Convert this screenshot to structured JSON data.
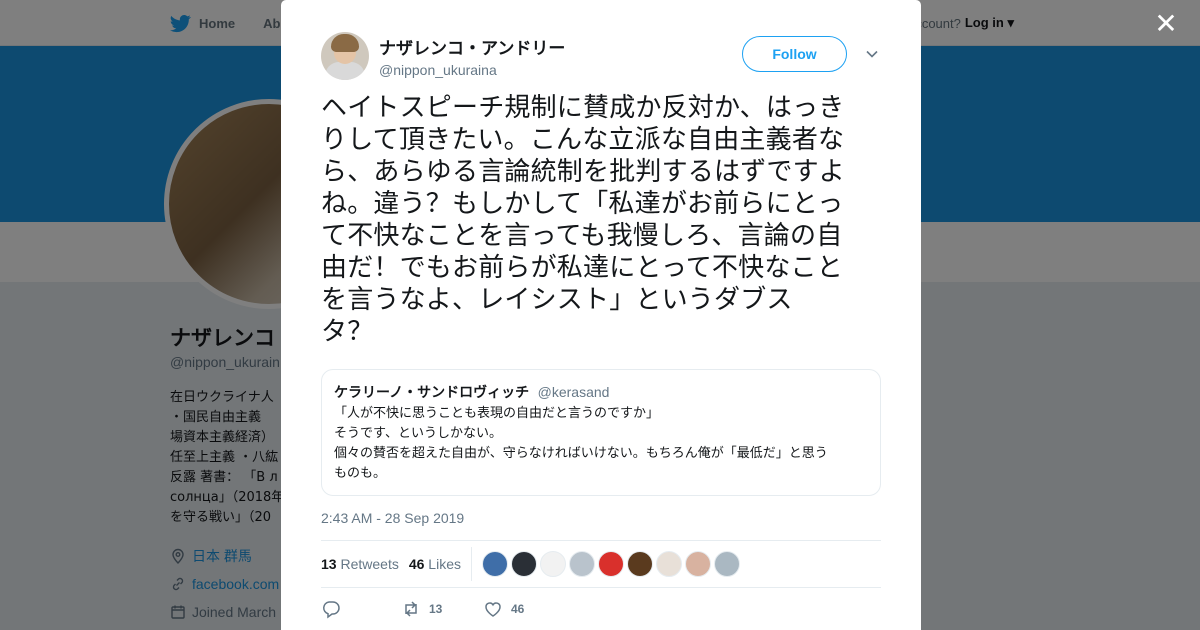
{
  "nav": {
    "home": "Home",
    "about_partial": "Abo",
    "account_partial": "ccount?",
    "login": "Log in"
  },
  "profile": {
    "name_partial": "ナザレンコ",
    "handle_partial": "@nippon_ukurain",
    "bio_lines": [
      "在日ウクライナ人",
      "・国民自由主義",
      "場資本主義経済）",
      "任至上主義 ・八紘",
      "反露 著書： 「В л",
      "солнца」（2018年",
      "を守る戦い」（20"
    ],
    "location": "日本 群馬",
    "website_partial": "facebook.com",
    "joined_partial": "Joined March"
  },
  "tweet": {
    "author_name": "ナザレンコ・アンドリー",
    "author_handle": "@nippon_ukuraina",
    "follow_label": "Follow",
    "text": "ヘイトスピーチ規制に賛成か反対か、はっき\nりして頂きたい。こんな立派な自由主義者な\nら、あらゆる言論統制を批判するはずですよ\nね。違う？もしかして「私達がお前らにとっ\nて不快なことを言っても我慢しろ、言論の自\n由だ！でもお前らが私達にとって不快なこと\nを言うなよ、レイシスト」というダブス\nタ？",
    "quote": {
      "name": "ケラリーノ・サンドロヴィッチ",
      "handle": "@kerasand",
      "text": "「人が不快に思うことも表現の自由だと言うのですか」\nそうです、というしかない。\n個々の賛否を超えた自由が、守らなければいけない。もちろん俺が「最低だ」と思う\nものも。"
    },
    "timestamp": "2:43 AM - 28 Sep 2019",
    "retweets_count": "13",
    "retweets_label": "Retweets",
    "likes_count": "46",
    "likes_label": "Likes",
    "action_retweets": "13",
    "action_likes": "46"
  },
  "icons": {
    "close": "close-icon",
    "twitter_bird": "twitter-bird-icon",
    "caret": "chevron-down-icon",
    "reply": "reply-icon",
    "retweet": "retweet-icon",
    "like": "heart-icon",
    "location": "location-pin-icon",
    "link": "link-icon",
    "calendar": "calendar-icon"
  },
  "colors": {
    "brand_blue": "#1da1f2",
    "banner": "#1b95e0",
    "secondary_text": "#657786",
    "liker_avatars": [
      "#3f6ea8",
      "#2a2f36",
      "#f2f2f2",
      "#b9c3cc",
      "#d9302c",
      "#5a3a1e",
      "#e8e0d8",
      "#d8b2a0",
      "#aab8c2"
    ]
  }
}
